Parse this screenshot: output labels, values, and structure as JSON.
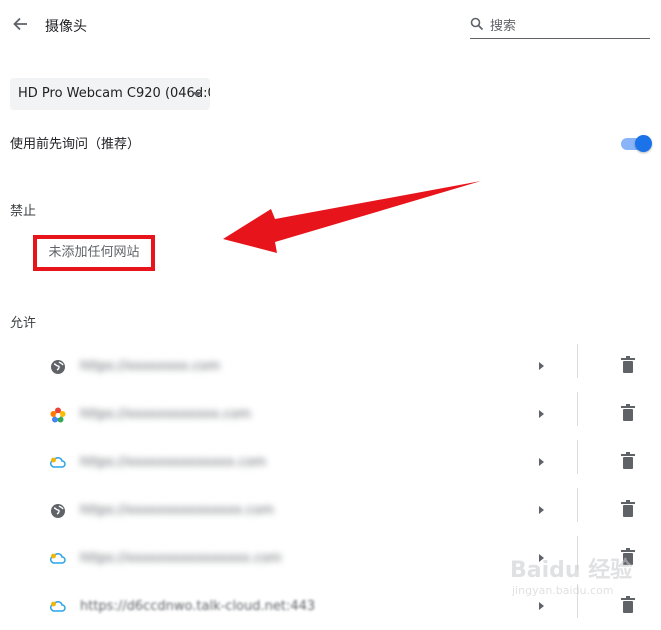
{
  "header": {
    "title": "摄像头",
    "search_placeholder": "搜索"
  },
  "camera_select": {
    "selected": "HD Pro Webcam C920 (046d:0"
  },
  "ask_before_access": {
    "label": "使用前先询问（推荐）",
    "enabled": true
  },
  "blocked": {
    "heading": "禁止",
    "empty_text": "未添加任何网站"
  },
  "allowed": {
    "heading": "允许",
    "sites": [
      {
        "icon": "globe-icon",
        "url": "https://xxxxxxxx.com"
      },
      {
        "icon": "colorful-flower-icon",
        "url": "https://xxxxxxxxxxxx.com"
      },
      {
        "icon": "cloud-icon",
        "url": "https://xxxxxxxxxxxxxx.com"
      },
      {
        "icon": "globe-icon",
        "url": "https://xxxxxxxxxxxxxxx.com"
      },
      {
        "icon": "cloud-icon",
        "url": "https://xxxxxxxxxxxxxxxx.com"
      },
      {
        "icon": "cloud-icon",
        "url": "https://d6ccdnwo.talk-cloud.net:443"
      }
    ]
  },
  "watermark": {
    "text": "Baidu 经验",
    "sub": "jingyan.baidu.com"
  },
  "colors": {
    "accent": "#1a73e8",
    "annotation_red": "#e8141b"
  }
}
